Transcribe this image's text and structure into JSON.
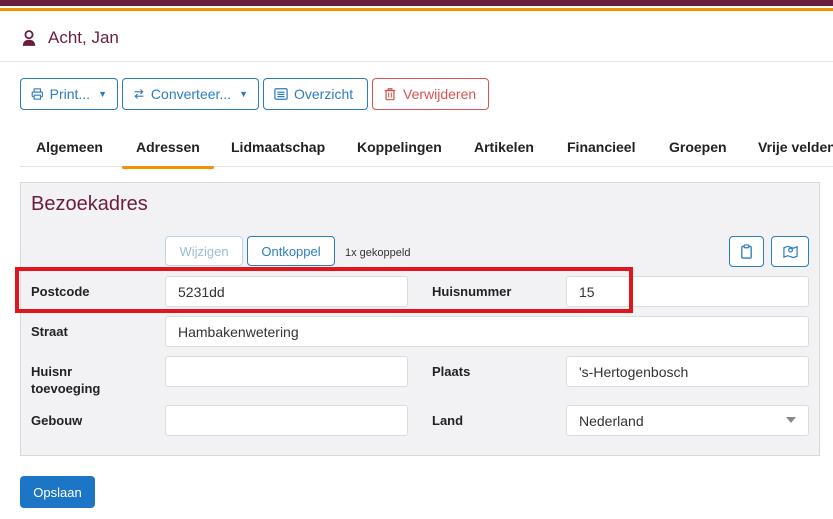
{
  "header": {
    "title": "Acht, Jan",
    "person_icon": "person-icon"
  },
  "toolbar": {
    "print_label": "Print...",
    "convert_label": "Converteer...",
    "overview_label": "Overzicht",
    "delete_label": "Verwijderen"
  },
  "tabs": [
    {
      "label": "Algemeen"
    },
    {
      "label": "Adressen",
      "active": true
    },
    {
      "label": "Lidmaatschap"
    },
    {
      "label": "Koppelingen"
    },
    {
      "label": "Artikelen"
    },
    {
      "label": "Financieel"
    },
    {
      "label": "Groepen"
    },
    {
      "label": "Vrije velden"
    }
  ],
  "address": {
    "section_title": "Bezoekadres",
    "edit_label": "Wijzigen",
    "unlink_label": "Ontkoppel",
    "linked_text": "1x gekoppeld",
    "fields": {
      "postcode_label": "Postcode",
      "postcode_value": "5231dd",
      "housenumber_label": "Huisnummer",
      "housenumber_value": "15",
      "street_label": "Straat",
      "street_value": "Hambakenwetering",
      "addition_label_1": "Huisnr",
      "addition_label_2": "toevoeging",
      "addition_value": "",
      "city_label": "Plaats",
      "city_value": "'s-Hertogenbosch",
      "building_label": "Gebouw",
      "building_value": "",
      "country_label": "Land",
      "country_value": "Nederland"
    }
  },
  "footer": {
    "save_label": "Opslaan"
  },
  "colors": {
    "accent": "#6b1d3f",
    "primary": "#2b7cc0",
    "danger": "#d9534f",
    "orange": "#f29200",
    "highlight": "#e0161f"
  }
}
